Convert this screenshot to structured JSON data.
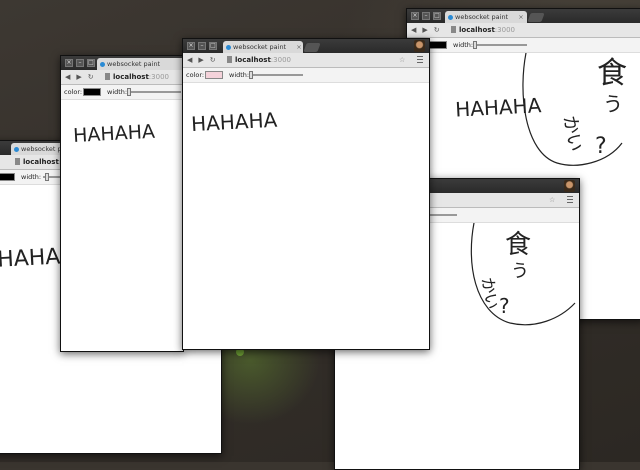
{
  "tab": {
    "title": "websocket paint",
    "close": "×"
  },
  "nav": {
    "back": "◀",
    "forward": "▶",
    "reload": "↻",
    "host": "localhost",
    "port": ":3000",
    "star": "☆"
  },
  "controls": {
    "color_label": "color:",
    "width_label": "width:"
  },
  "window_buttons": {
    "close": "×",
    "minimize": "–",
    "maximize": "□"
  },
  "drawing": {
    "laugh_text": "HAHAHA",
    "kanji_eat": "食",
    "kana_u": "う",
    "kana_kai": "かい",
    "question": "?"
  },
  "colors": {
    "pen_black": "#000000",
    "pen_pink": "#f4d2da",
    "eye_red": "#b0202a",
    "blush": "#f0c6cf"
  }
}
